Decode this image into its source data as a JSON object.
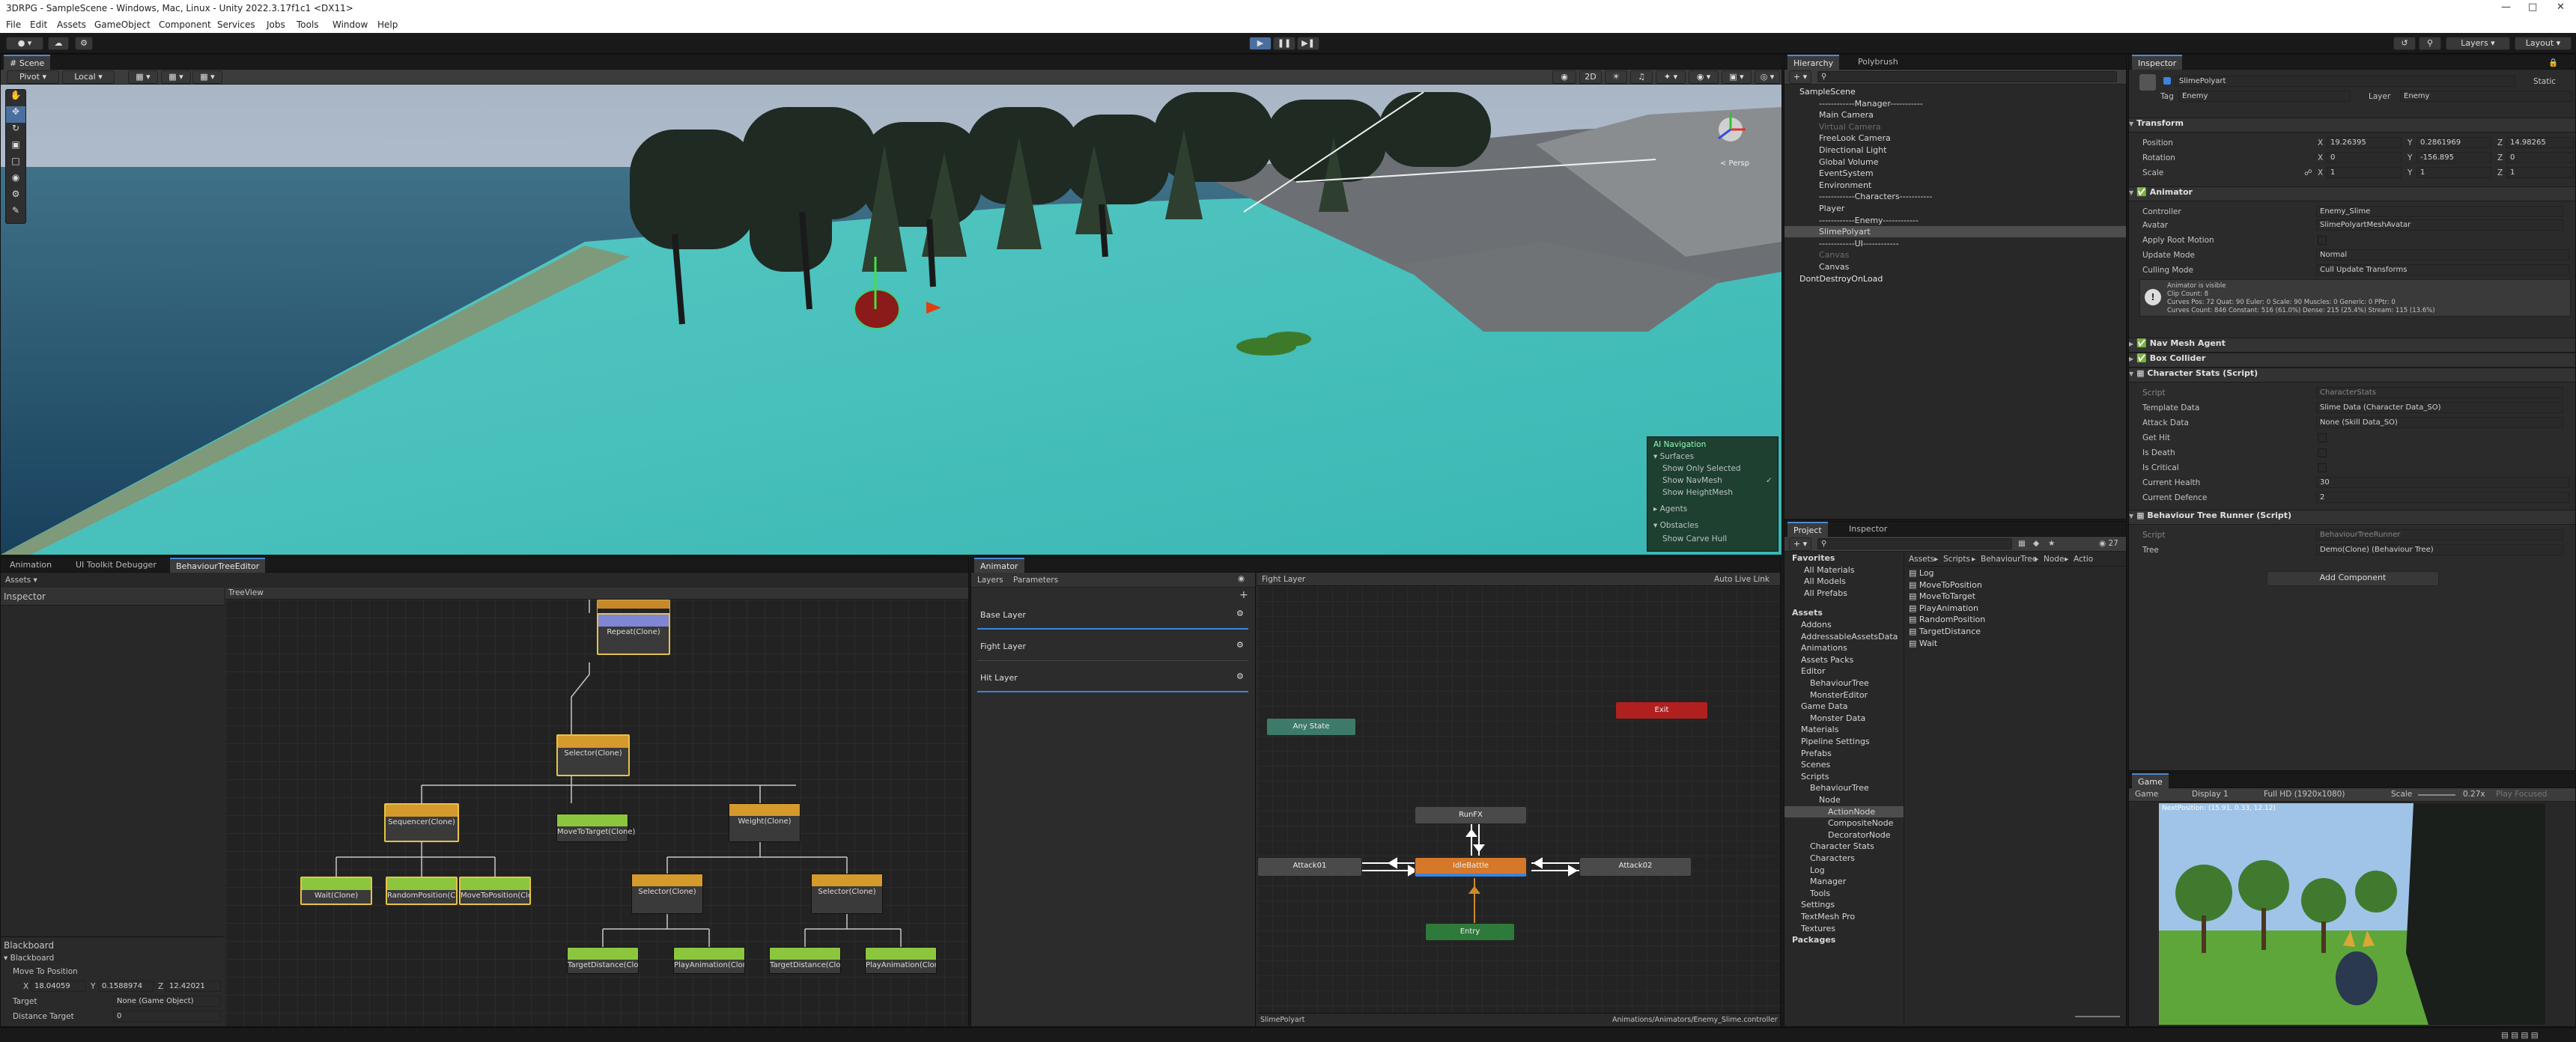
{
  "window": {
    "title": "3DRPG - SampleScene - Windows, Mac, Linux - Unity 2022.3.17f1c1 <DX11>"
  },
  "menu": [
    "File",
    "Edit",
    "Assets",
    "GameObject",
    "Component",
    "Services",
    "Jobs",
    "Tools",
    "Window",
    "Help"
  ],
  "toolbar": {
    "layers_label": "Layers",
    "layout_label": "Layout"
  },
  "scene": {
    "tab": "Scene",
    "pivot": "Pivot",
    "local": "Local",
    "mode_2d": "2D",
    "persp": "< Persp",
    "nav_overlay": {
      "title": "AI Navigation",
      "surfaces": "Surfaces",
      "show_only_selected": "Show Only Selected",
      "show_navmesh": "Show NavMesh",
      "show_heightmesh": "Show HeightMesh",
      "agents": "Agents",
      "obstacles": "Obstacles",
      "show_carve_hull": "Show Carve Hull"
    }
  },
  "hierarchy": {
    "tabs": [
      "Hierarchy",
      "Polybrush"
    ],
    "items": [
      {
        "label": "SampleScene",
        "depth": 0
      },
      {
        "label": "------------Manager-----------",
        "depth": 1
      },
      {
        "label": "Main Camera",
        "depth": 1
      },
      {
        "label": "Virtual Camera",
        "depth": 1,
        "dim": true
      },
      {
        "label": "FreeLook Camera",
        "depth": 1
      },
      {
        "label": "Directional Light",
        "depth": 1
      },
      {
        "label": "Global Volume",
        "depth": 1
      },
      {
        "label": "EventSystem",
        "depth": 1
      },
      {
        "label": "Environment",
        "depth": 1
      },
      {
        "label": "------------Characters-----------",
        "depth": 1
      },
      {
        "label": "Player",
        "depth": 1
      },
      {
        "label": "------------Enemy------------",
        "depth": 1
      },
      {
        "label": "SlimePolyart",
        "depth": 1,
        "selected": true
      },
      {
        "label": "------------UI------------",
        "depth": 1
      },
      {
        "label": "Canvas",
        "depth": 1,
        "dim": true
      },
      {
        "label": "Canvas",
        "depth": 1
      },
      {
        "label": "DontDestroyOnLoad",
        "depth": 0
      }
    ]
  },
  "inspector": {
    "tab": "Inspector",
    "object_name": "SlimePolyart",
    "static_label": "Static",
    "tag_label": "Tag",
    "tag_value": "Enemy",
    "layer_label": "Layer",
    "layer_value": "Enemy",
    "transform": {
      "title": "Transform",
      "position_label": "Position",
      "px": "19.26395",
      "py": "0.2861969",
      "pz": "14.98265",
      "rotation_label": "Rotation",
      "rx": "0",
      "ry": "-156.895",
      "rz": "0",
      "scale_label": "Scale",
      "sx": "1",
      "sy": "1",
      "sz": "1"
    },
    "animator": {
      "title": "Animator",
      "controller_label": "Controller",
      "controller_value": "Enemy_Slime",
      "avatar_label": "Avatar",
      "avatar_value": "SlimePolyartMeshAvatar",
      "root_motion_label": "Apply Root Motion",
      "update_mode_label": "Update Mode",
      "update_mode_value": "Normal",
      "culling_label": "Culling Mode",
      "culling_value": "Cull Update Transforms",
      "info_line1": "Animator is visible",
      "info_line2": "Clip Count: 8",
      "info_line3": "Curves Pos: 72 Quat: 90 Euler: 0 Scale: 90 Muscles: 0 Generic: 0 PPtr: 0",
      "info_line4": "Curves Count: 846 Constant: 516 (61.0%) Dense: 215 (25.4%) Stream: 115 (13.6%)"
    },
    "nav_mesh_agent": "Nav Mesh Agent",
    "box_collider": "Box Collider",
    "character_stats": {
      "title": "Character Stats (Script)",
      "script_label": "Script",
      "script_value": "CharacterStats",
      "template_label": "Template Data",
      "template_value": "Slime Data (Character Data_SO)",
      "attack_label": "Attack Data",
      "attack_value": "None (Skill Data_SO)",
      "get_hit_label": "Get Hit",
      "is_death_label": "Is Death",
      "is_critical_label": "Is Critical",
      "health_label": "Current Health",
      "health_value": "30",
      "defence_label": "Current Defence",
      "defence_value": "2"
    },
    "bt_runner": {
      "title": "Behaviour Tree Runner (Script)",
      "script_label": "Script",
      "script_value": "BehaviourTreeRunner",
      "tree_label": "Tree",
      "tree_value": "Demo(Clone) (Behaviour Tree)"
    },
    "add_component": "Add Component"
  },
  "bottom_left": {
    "tabs": [
      "Animation",
      "UI Toolkit Debugger",
      "BehaviourTreeEditor"
    ],
    "assets_menu": "Assets",
    "inspector_label": "Inspector",
    "treeview_label": "TreeView",
    "blackboard_title": "Blackboard",
    "blackboard_sub": "Blackboard",
    "move_to_label": "Move To Position",
    "mx": "18.04059",
    "my": "0.1588974",
    "mz": "12.42021",
    "target_label": "Target",
    "target_value": "None (Game Object)",
    "distance_label": "Distance Target",
    "distance_value": "0",
    "nodes": [
      {
        "id": "repeat",
        "label": "Repeat(Clone)"
      },
      {
        "id": "selector1",
        "label": "Selector(Clone)"
      },
      {
        "id": "sequencer",
        "label": "Sequencer(Clone)"
      },
      {
        "id": "movetotarget",
        "label": "MoveToTarget(Clone)"
      },
      {
        "id": "weight",
        "label": "Weight(Clone)"
      },
      {
        "id": "wait",
        "label": "Wait(Clone)"
      },
      {
        "id": "randompos",
        "label": "RandomPosition(Clone)"
      },
      {
        "id": "movetopos",
        "label": "MoveToPosition(Clone)"
      },
      {
        "id": "selector2",
        "label": "Selector(Clone)"
      },
      {
        "id": "selector3",
        "label": "Selector(Clone)"
      },
      {
        "id": "targetdist1",
        "label": "TargetDistance(Clone)"
      },
      {
        "id": "playanim1",
        "label": "PlayAnimation(Clone)"
      },
      {
        "id": "targetdist2",
        "label": "TargetDistance(Clone)"
      },
      {
        "id": "playanim2",
        "label": "PlayAnimation(Clone)"
      }
    ]
  },
  "animator_window": {
    "tab": "Animator",
    "layers_tab": "Layers",
    "parameters_tab": "Parameters",
    "layers": [
      "Base Layer",
      "Fight Layer",
      "Hit Layer"
    ],
    "breadcrumb": "Fight Layer",
    "auto_live_link": "Auto Live Link",
    "states": {
      "any": "Any State",
      "exit": "Exit",
      "runfx": "RunFX",
      "attack01": "Attack01",
      "idle": "IdleBattle",
      "attack02": "Attack02",
      "entry": "Entry"
    },
    "footer_left": "SlimePolyart",
    "footer_right": "Animations/Animators/Enemy_Slime.controller"
  },
  "project": {
    "tabs": [
      "Project",
      "Inspector"
    ],
    "count": "27",
    "breadcrumb": [
      "Assets",
      "Scripts",
      "BehaviourTree",
      "Node",
      "Actio"
    ],
    "favorites": "Favorites",
    "fav_items": [
      "All Materials",
      "All Models",
      "All Prefabs"
    ],
    "tree": [
      {
        "label": "Assets",
        "depth": 0,
        "bold": true
      },
      {
        "label": "Addons",
        "depth": 1
      },
      {
        "label": "AddressableAssetsData",
        "depth": 1
      },
      {
        "label": "Animations",
        "depth": 1
      },
      {
        "label": "Assets Packs",
        "depth": 1
      },
      {
        "label": "Editor",
        "depth": 1
      },
      {
        "label": "BehaviourTree",
        "depth": 2
      },
      {
        "label": "MonsterEditor",
        "depth": 2
      },
      {
        "label": "Game Data",
        "depth": 1
      },
      {
        "label": "Monster Data",
        "depth": 2
      },
      {
        "label": "Materials",
        "depth": 1
      },
      {
        "label": "Pipeline Settings",
        "depth": 1
      },
      {
        "label": "Prefabs",
        "depth": 1
      },
      {
        "label": "Scenes",
        "depth": 1
      },
      {
        "label": "Scripts",
        "depth": 1
      },
      {
        "label": "BehaviourTree",
        "depth": 2
      },
      {
        "label": "Node",
        "depth": 3
      },
      {
        "label": "ActionNode",
        "depth": 4,
        "selected": true
      },
      {
        "label": "CompositeNode",
        "depth": 4
      },
      {
        "label": "DecoratorNode",
        "depth": 4
      },
      {
        "label": "Character Stats",
        "depth": 2
      },
      {
        "label": "Characters",
        "depth": 2
      },
      {
        "label": "Log",
        "depth": 2
      },
      {
        "label": "Manager",
        "depth": 2
      },
      {
        "label": "Tools",
        "depth": 2
      },
      {
        "label": "Settings",
        "depth": 1
      },
      {
        "label": "TextMesh Pro",
        "depth": 1
      },
      {
        "label": "Textures",
        "depth": 1
      },
      {
        "label": "Packages",
        "depth": 0,
        "bold": true
      }
    ],
    "files": [
      "Log",
      "MoveToPosition",
      "MoveToTarget",
      "PlayAnimation",
      "RandomPosition",
      "TargetDistance",
      "Wait"
    ]
  },
  "game": {
    "tab": "Game",
    "mode": "Game",
    "display": "Display 1",
    "resolution": "Full HD (1920x1080)",
    "scale_label": "Scale",
    "scale_value": "0.27x",
    "play_focused": "Play Focused",
    "overlay_text": "NextPosition: (15.91, 0.33, 12.12)"
  }
}
